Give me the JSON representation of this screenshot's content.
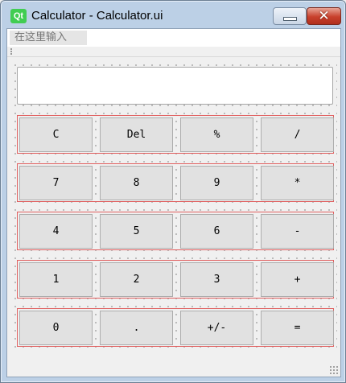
{
  "window": {
    "logo_text": "Qt",
    "title": "Calculator - Calculator.ui",
    "close_glyph": "✕"
  },
  "menubar": {
    "placeholder_label": "在这里输入"
  },
  "display": {
    "value": ""
  },
  "keypad": {
    "rows": [
      [
        "C",
        "Del",
        "%",
        "/"
      ],
      [
        "7",
        "8",
        "9",
        "*"
      ],
      [
        "4",
        "5",
        "6",
        "-"
      ],
      [
        "1",
        "2",
        "3",
        "+"
      ],
      [
        "0",
        ".",
        "+/-",
        "="
      ]
    ]
  }
}
